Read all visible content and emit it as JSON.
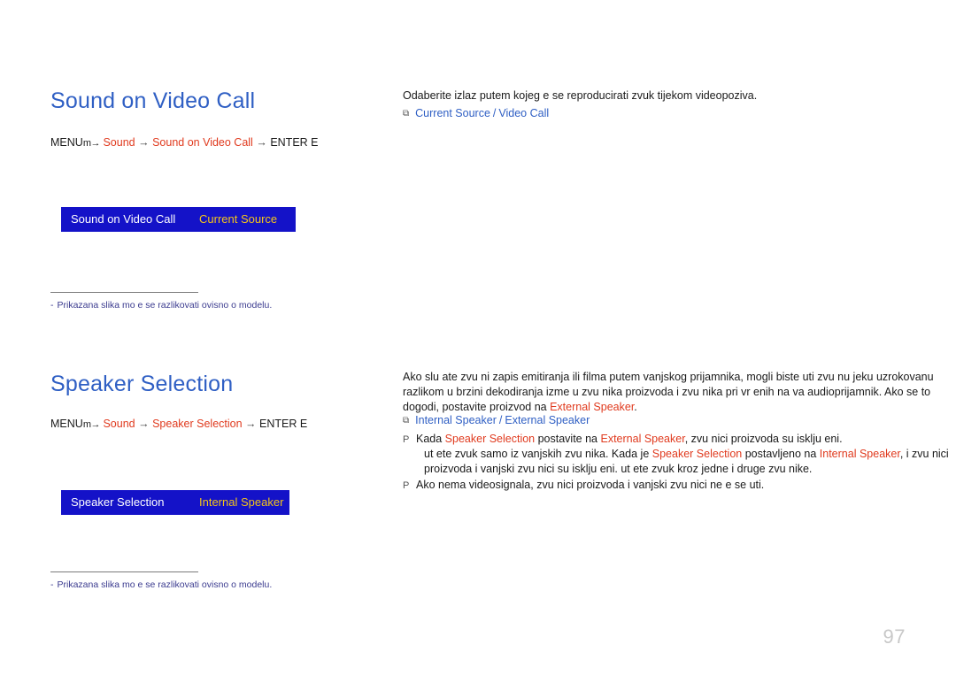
{
  "sections": [
    {
      "title": "Sound on Video Call",
      "menu_path": {
        "prefix": "MENU",
        "menu_icon": "m→",
        "items": [
          "Sound",
          "Sound on Video Call"
        ],
        "suffix": "ENTER E",
        "arrow": "→"
      },
      "osd": {
        "left_label": "Sound on Video Call",
        "right_value": "Current Source"
      },
      "note": "Prikazana slika mo e se razlikovati ovisno o modelu.",
      "note_bullet": "‑",
      "description": "Odaberite izlaz putem kojeg  e se reproducirati zvuk tijekom videopoziva.",
      "options": [
        "Current Source",
        "Video Call"
      ],
      "options_separator": "/"
    },
    {
      "title": "Speaker Selection",
      "menu_path": {
        "prefix": "MENU",
        "menu_icon": "m→",
        "items": [
          "Sound",
          "Speaker Selection"
        ],
        "suffix": "ENTER E",
        "arrow": "→"
      },
      "osd": {
        "left_label": "Speaker Selection",
        "right_value": "Internal Speaker"
      },
      "note": "Prikazana slika mo e se razlikovati ovisno o modelu.",
      "note_bullet": "‑",
      "description_part1": "Ako slu ate zvu ni zapis emitiranja ili filma putem vanjskog prijamnika, mogli biste  uti zvu nu jeku uzrokovanu razlikom u brzini dekodiranja izme u zvu nika proizvoda i zvu nika pri vr  enih na va  audioprijamnik. Ako se to dogodi, postavite proizvod na ",
      "description_keyword": "External Speaker",
      "description_part2": ".",
      "options": [
        "Internal Speaker",
        "External Speaker"
      ],
      "options_separator": "/",
      "paragraphs": [
        {
          "mark": "P",
          "runs": [
            {
              "text": "Kada ",
              "style": "normal"
            },
            {
              "text": "Speaker Selection",
              "style": "red"
            },
            {
              "text": " postavite na ",
              "style": "normal"
            },
            {
              "text": "External Speaker",
              "style": "red"
            },
            {
              "text": ", zvu nici proizvoda su isklju eni.",
              "style": "normal"
            }
          ],
          "indent_runs": [
            {
              "text": " ut ete zvuk samo iz vanjskih zvu nika. Kada je ",
              "style": "normal"
            },
            {
              "text": "Speaker Selection",
              "style": "red"
            },
            {
              "text": " postavljeno na ",
              "style": "normal"
            },
            {
              "text": "Internal Speaker",
              "style": "red"
            },
            {
              "text": ", i zvu nici proizvoda i vanjski zvu nici su isklju eni.  ut ete zvuk kroz jedne i druge zvu nike.",
              "style": "normal"
            }
          ]
        },
        {
          "mark": "P",
          "runs": [
            {
              "text": "Ako nema videosignala, zvu nici proizvoda i vanjski zvu nici ne  e se  uti.",
              "style": "normal"
            }
          ]
        }
      ]
    }
  ],
  "page_number": "97",
  "colors": {
    "heading": "#2f5fc4",
    "keyword_red": "#e03a1e",
    "osd_background": "#1412c8",
    "osd_value": "#f5c518",
    "note": "#3b3b8f",
    "page_number": "#c8c8c8"
  }
}
